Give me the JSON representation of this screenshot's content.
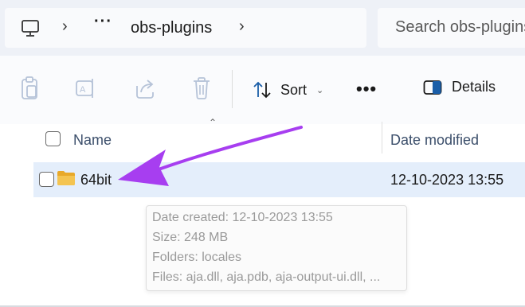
{
  "address_bar": {
    "breadcrumb_overflow": "···",
    "current_folder": "obs-plugins",
    "search_placeholder": "Search obs-plugins"
  },
  "toolbar": {
    "sort_label": "Sort",
    "more_label": "•••",
    "details_label": "Details",
    "icons": [
      "paste-icon",
      "rename-icon",
      "share-icon",
      "delete-icon",
      "sort-icon",
      "details-icon"
    ]
  },
  "columns": {
    "name": "Name",
    "date_modified": "Date modified"
  },
  "files": [
    {
      "name": "64bit",
      "date_modified": "12-10-2023 13:55",
      "type": "folder"
    }
  ],
  "tooltip": {
    "date_created": "Date created: 12-10-2023 13:55",
    "size": "Size: 248 MB",
    "folders": "Folders: locales",
    "files": "Files: aja.dll, aja.pdb, aja-output-ui.dll, ..."
  },
  "colors": {
    "annotation_arrow": "#a73ef0",
    "selected_row": "#e4eefb",
    "folder": "#f4c451"
  }
}
